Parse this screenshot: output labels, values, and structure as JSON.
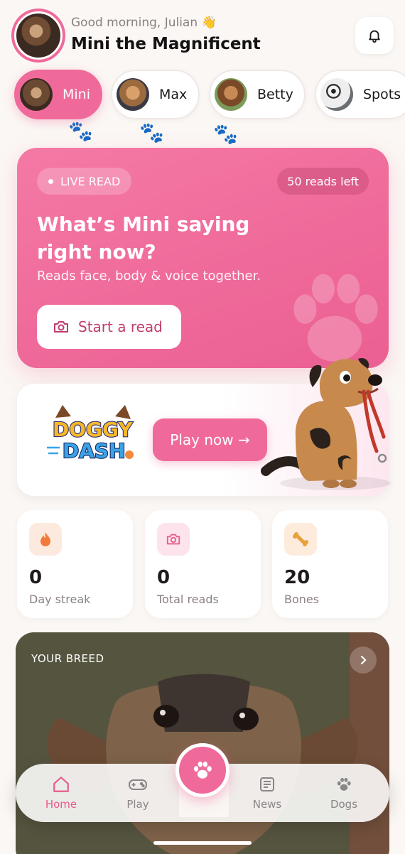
{
  "header": {
    "greeting": "Good morning, Julian 👋",
    "dog_name": "Mini the Magnificent"
  },
  "dogs": [
    {
      "name": "Mini",
      "active": true
    },
    {
      "name": "Max",
      "active": false
    },
    {
      "name": "Betty",
      "active": false
    },
    {
      "name": "Spots",
      "active": false
    }
  ],
  "live_read": {
    "badge": "LIVE READ",
    "reads_left": "50 reads left",
    "title": "What’s Mini saying right now?",
    "subtitle": "Reads face, body & voice together.",
    "button": "Start a read"
  },
  "game": {
    "logo_line1": "DOGGY",
    "logo_line2": "DASH",
    "button": "Play now →"
  },
  "stats": [
    {
      "value": "0",
      "label": "Day streak",
      "icon": "flame-icon"
    },
    {
      "value": "0",
      "label": "Total reads",
      "icon": "camera-icon"
    },
    {
      "value": "20",
      "label": "Bones",
      "icon": "bone-icon"
    }
  ],
  "breed": {
    "label": "YOUR BREED"
  },
  "nav": {
    "home": "Home",
    "play": "Play",
    "news": "News",
    "dogs": "Dogs"
  },
  "colors": {
    "accent": "#ef6a9a",
    "background": "#fbf7f4"
  }
}
